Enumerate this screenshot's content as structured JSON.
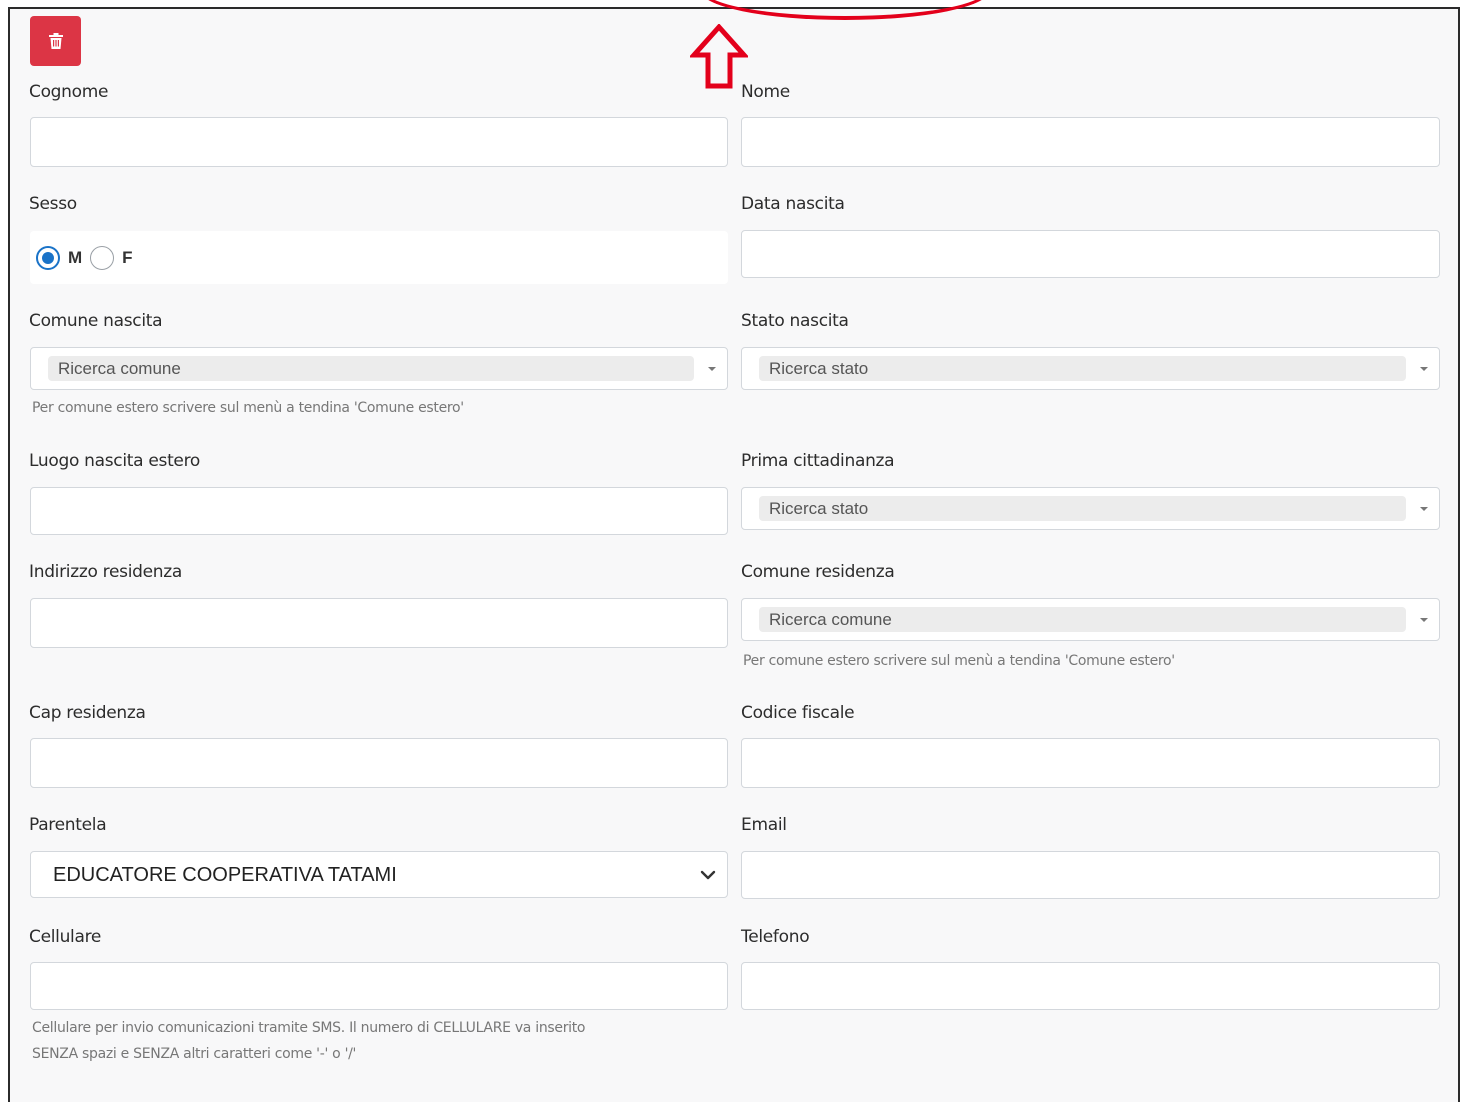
{
  "form": {
    "delete_icon": "trash-icon",
    "fields": {
      "cognome": {
        "label": "Cognome",
        "value": ""
      },
      "nome": {
        "label": "Nome",
        "value": ""
      },
      "sesso": {
        "label": "Sesso",
        "options": [
          "M",
          "F"
        ],
        "selected": "M"
      },
      "data_nascita": {
        "label": "Data nascita",
        "value": ""
      },
      "comune_nascita": {
        "label": "Comune nascita",
        "placeholder": "Ricerca comune",
        "help": "Per comune estero scrivere sul menù a tendina 'Comune estero'"
      },
      "stato_nascita": {
        "label": "Stato nascita",
        "placeholder": "Ricerca stato"
      },
      "luogo_nascita_estero": {
        "label": "Luogo nascita estero",
        "value": ""
      },
      "prima_cittadinanza": {
        "label": "Prima cittadinanza",
        "placeholder": "Ricerca stato"
      },
      "indirizzo_residenza": {
        "label": "Indirizzo residenza",
        "value": ""
      },
      "comune_residenza": {
        "label": "Comune residenza",
        "placeholder": "Ricerca comune",
        "help": "Per comune estero scrivere sul menù a tendina 'Comune estero'"
      },
      "cap_residenza": {
        "label": "Cap residenza",
        "value": ""
      },
      "codice_fiscale": {
        "label": "Codice fiscale",
        "value": ""
      },
      "parentela": {
        "label": "Parentela",
        "selected": "EDUCATORE COOPERATIVA TATAMI"
      },
      "email": {
        "label": "Email",
        "value": ""
      },
      "cellulare": {
        "label": "Cellulare",
        "value": "",
        "help_line1": "Cellulare per invio comunicazioni tramite SMS. Il numero di CELLULARE va inserito",
        "help_line2": "SENZA spazi e SENZA altri caratteri come '-' o '/'"
      },
      "telefono": {
        "label": "Telefono",
        "value": ""
      }
    }
  },
  "annotation": {
    "color": "#e3001b",
    "shapes": [
      "red-circle",
      "up-arrow-icon"
    ]
  },
  "colors": {
    "delete_button": "#dc3545",
    "radio_accent": "#1a73c8"
  }
}
